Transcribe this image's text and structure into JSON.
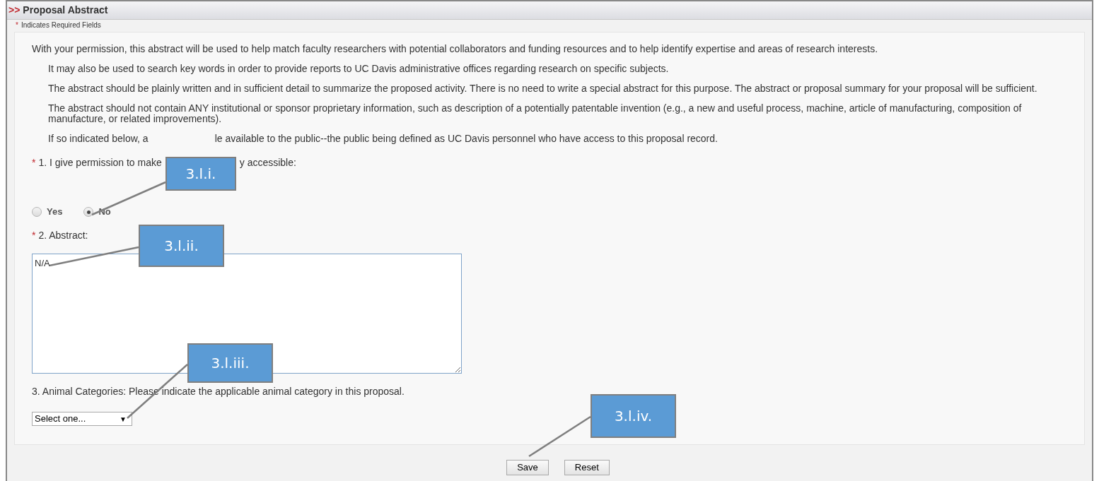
{
  "section": {
    "marker": ">>",
    "title": "Proposal Abstract"
  },
  "required_note": {
    "marker": "*",
    "text": "Indicates Required Fields"
  },
  "intro": "With your permission, this abstract will be used to help match faculty researchers with potential collaborators and funding resources and to help identify expertise and areas of research interests.",
  "paragraphs": [
    {
      "parts": [
        "It may also be used to search key words in order to provide reports to UC Davis administrative offices regarding research on specific subjects."
      ]
    },
    {
      "parts": [
        "The abstract should be plainly written and in sufficient detail to summarize the proposed activity. There is no need to write a special abstract for this purpose. The abstract or proposal summary for your proposal will be sufficient."
      ]
    },
    {
      "parts": [
        "The abstract should not contain ANY institutional or sponsor proprietary information, such as description of a potentially patentable invention (e.g., a new and useful process, machine, article of manufacturing, composition of manufacture, or related improvements)."
      ]
    },
    {
      "parts": [
        "If so indicated below, a",
        "le available to the public--the public being defined as UC Davis personnel who have access to this proposal record."
      ]
    }
  ],
  "question1": {
    "marker": "*",
    "parts": [
      "1. I give permission to make",
      "y accessible:"
    ],
    "options": [
      {
        "label": "Yes",
        "selected": false
      },
      {
        "label": "No",
        "selected": true
      }
    ]
  },
  "question2": {
    "marker": "*",
    "label": "2. Abstract:",
    "value": "N/A"
  },
  "question3": {
    "label": "3. Animal Categories: Please indicate the applicable animal category in this proposal.",
    "select": "Select one...",
    "caret": "▼"
  },
  "buttons": [
    "Save",
    "Reset"
  ],
  "callouts": [
    {
      "label": "3.l.i."
    },
    {
      "label": "3.l.ii."
    },
    {
      "label": "3.l.iii."
    },
    {
      "label": "3.l.iv."
    }
  ]
}
